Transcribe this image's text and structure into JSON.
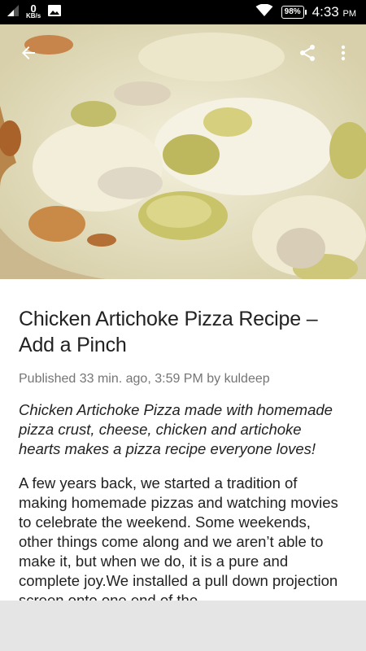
{
  "status_bar": {
    "net_speed_value": "0",
    "net_speed_unit": "KB/s",
    "battery": "98%",
    "time": "4:33",
    "ampm": "PM",
    "icons": [
      "signal-icon",
      "image-notification-icon",
      "wifi-icon",
      "battery-icon"
    ]
  },
  "toolbar": {
    "icons": [
      "back-arrow-icon",
      "share-icon",
      "more-vert-icon"
    ]
  },
  "article": {
    "title": "Chicken Artichoke Pizza Recipe – Add a Pinch",
    "meta": "Published 33 min. ago, 3:59 PM by kuldeep",
    "excerpt": "Chicken Artichoke Pizza made with homemade pizza crust, cheese, chicken and artichoke hearts makes a pizza recipe everyone loves!",
    "body": "A few years back, we started a tradition of making homemade pizzas and watching movies to celebrate the weekend. Some weekends, other things come along and we aren’t able to make it, but when we do, it is a pure and complete joy.We installed a pull down projection screen onto one end of the"
  },
  "colors": {
    "status_bar_bg": "#000000",
    "meta_text": "#757575",
    "bottom_bar": "#e5e5e5"
  }
}
